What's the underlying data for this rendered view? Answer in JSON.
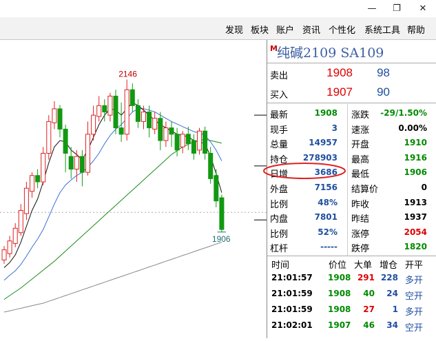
{
  "window": {
    "minimize_glyph": "—",
    "restore_glyph": "❐",
    "close_glyph": "✕"
  },
  "menu": {
    "items": [
      "发现",
      "板块",
      "账户",
      "资讯",
      "个性化",
      "系统工具",
      "帮助"
    ]
  },
  "header": {
    "marker": "M",
    "title": "纯碱2109  SA109"
  },
  "quote": {
    "sell_label": "卖出",
    "sell_price": "1908",
    "sell_qty": "98",
    "buy_label": "买入",
    "buy_price": "1907",
    "buy_qty": "90"
  },
  "stats": [
    {
      "l1": "最新",
      "v1": "1908",
      "c1": "green",
      "l2": "涨跌",
      "v2": "-29/1.50%",
      "c2": "green"
    },
    {
      "l1": "现手",
      "v1": "3",
      "c1": "blue",
      "l2": "速涨",
      "v2": "0.00%",
      "c2": "black"
    },
    {
      "l1": "总量",
      "v1": "14957",
      "c1": "blue",
      "l2": "开盘",
      "v2": "1910",
      "c2": "green"
    },
    {
      "l1": "持仓",
      "v1": "278903",
      "c1": "blue",
      "l2": "最高",
      "v2": "1916",
      "c2": "green"
    },
    {
      "l1": "日增",
      "v1": "3686",
      "c1": "blue",
      "l2": "最低",
      "v2": "1906",
      "c2": "green"
    },
    {
      "l1": "外盘",
      "v1": "7156",
      "c1": "blue",
      "l2": "结算价",
      "v2": "0",
      "c2": "black"
    },
    {
      "l1": "比例",
      "v1": "48%",
      "c1": "blue",
      "l2": "昨收",
      "v2": "1913",
      "c2": "black"
    },
    {
      "l1": "内盘",
      "v1": "7801",
      "c1": "blue",
      "l2": "昨结",
      "v2": "1937",
      "c2": "black"
    },
    {
      "l1": "比例",
      "v1": "52%",
      "c1": "blue",
      "l2": "涨停",
      "v2": "2054",
      "c2": "red"
    },
    {
      "l1": "杠杆",
      "v1": "-----",
      "c1": "blue",
      "l2": "跌停",
      "v2": "1820",
      "c2": "green"
    }
  ],
  "ticks": {
    "headers": [
      "时间",
      "价位",
      "大单",
      "增仓",
      "开平"
    ],
    "rows": [
      {
        "time": "21:01:57",
        "price": "1908",
        "vol": "291",
        "vol_color": "red",
        "oi": "228",
        "type": "多开"
      },
      {
        "time": "21:01:59",
        "price": "1908",
        "vol": "40",
        "vol_color": "green",
        "oi": "24",
        "type": "空开"
      },
      {
        "time": "21:01:59",
        "price": "1908",
        "vol": "27",
        "vol_color": "red",
        "oi": "1",
        "type": "多开"
      },
      {
        "time": "21:02:01",
        "price": "1907",
        "vol": "46",
        "vol_color": "green",
        "oi": "34",
        "type": "空开"
      }
    ]
  },
  "chart_data": {
    "type": "candlestick",
    "high_label": "2146",
    "low_label": "1906",
    "candles": [
      {
        "o": 1862,
        "c": 1878,
        "h": 1884,
        "l": 1856
      },
      {
        "o": 1872,
        "c": 1892,
        "h": 1900,
        "l": 1866
      },
      {
        "o": 1888,
        "c": 1912,
        "h": 1920,
        "l": 1882
      },
      {
        "o": 1905,
        "c": 1940,
        "h": 1950,
        "l": 1900
      },
      {
        "o": 1935,
        "c": 1975,
        "h": 1985,
        "l": 1925
      },
      {
        "o": 1970,
        "c": 1995,
        "h": 2000,
        "l": 1960
      },
      {
        "o": 1995,
        "c": 1985,
        "h": 2005,
        "l": 1975
      },
      {
        "o": 1985,
        "c": 2030,
        "h": 2040,
        "l": 1980
      },
      {
        "o": 2030,
        "c": 2080,
        "h": 2090,
        "l": 2020
      },
      {
        "o": 2078,
        "c": 2100,
        "h": 2112,
        "l": 2068
      },
      {
        "o": 2100,
        "c": 2068,
        "h": 2106,
        "l": 2055
      },
      {
        "o": 2068,
        "c": 2030,
        "h": 2075,
        "l": 2000
      },
      {
        "o": 2025,
        "c": 2005,
        "h": 2040,
        "l": 1990
      },
      {
        "o": 2005,
        "c": 2025,
        "h": 2035,
        "l": 1985
      },
      {
        "o": 2025,
        "c": 2000,
        "h": 2035,
        "l": 1978
      },
      {
        "o": 2000,
        "c": 2060,
        "h": 2080,
        "l": 1995
      },
      {
        "o": 2060,
        "c": 2090,
        "h": 2105,
        "l": 2050
      },
      {
        "o": 2088,
        "c": 2105,
        "h": 2120,
        "l": 2080
      },
      {
        "o": 2105,
        "c": 2095,
        "h": 2115,
        "l": 2080
      },
      {
        "o": 2090,
        "c": 2120,
        "h": 2125,
        "l": 2080
      },
      {
        "o": 2120,
        "c": 2070,
        "h": 2130,
        "l": 2060
      },
      {
        "o": 2070,
        "c": 2060,
        "h": 2110,
        "l": 2048
      },
      {
        "o": 2060,
        "c": 2130,
        "h": 2146,
        "l": 2050
      },
      {
        "o": 2130,
        "c": 2105,
        "h": 2140,
        "l": 2095
      },
      {
        "o": 2105,
        "c": 2080,
        "h": 2115,
        "l": 2070
      },
      {
        "o": 2080,
        "c": 2095,
        "h": 2105,
        "l": 2068
      },
      {
        "o": 2095,
        "c": 2070,
        "h": 2105,
        "l": 2055
      },
      {
        "o": 2068,
        "c": 2085,
        "h": 2095,
        "l": 2060
      },
      {
        "o": 2085,
        "c": 2050,
        "h": 2095,
        "l": 2035
      },
      {
        "o": 2050,
        "c": 2070,
        "h": 2080,
        "l": 2040
      },
      {
        "o": 2070,
        "c": 2060,
        "h": 2080,
        "l": 2040
      },
      {
        "o": 2060,
        "c": 2035,
        "h": 2070,
        "l": 2025
      },
      {
        "o": 2040,
        "c": 2060,
        "h": 2065,
        "l": 2030
      },
      {
        "o": 2060,
        "c": 2045,
        "h": 2072,
        "l": 2035
      },
      {
        "o": 2050,
        "c": 2030,
        "h": 2060,
        "l": 2020
      },
      {
        "o": 2035,
        "c": 2065,
        "h": 2070,
        "l": 2028
      },
      {
        "o": 2065,
        "c": 2030,
        "h": 2072,
        "l": 2020
      },
      {
        "o": 2030,
        "c": 1990,
        "h": 2040,
        "l": 1982
      },
      {
        "o": 1995,
        "c": 1955,
        "h": 2005,
        "l": 1945
      },
      {
        "o": 1960,
        "c": 1910,
        "h": 1965,
        "l": 1906
      }
    ],
    "ma_fast": [
      1850,
      1858,
      1870,
      1890,
      1915,
      1940,
      1958,
      1985,
      2015,
      2040,
      2050,
      2048,
      2035,
      2028,
      2020,
      2035,
      2055,
      2075,
      2090,
      2100,
      2098,
      2090,
      2100,
      2110,
      2105,
      2098,
      2090,
      2082,
      2075,
      2070,
      2065,
      2060,
      2058,
      2056,
      2050,
      2048,
      2045,
      2025,
      1998,
      1968
    ],
    "ma_mid": [
      1830,
      1838,
      1845,
      1855,
      1868,
      1882,
      1895,
      1910,
      1930,
      1950,
      1968,
      1980,
      1988,
      1995,
      2000,
      2008,
      2018,
      2030,
      2045,
      2058,
      2068,
      2075,
      2085,
      2095,
      2100,
      2100,
      2098,
      2095,
      2090,
      2085,
      2080,
      2076,
      2072,
      2068,
      2064,
      2062,
      2058,
      2048,
      2035,
      2018
    ],
    "ma_slow": [
      1800,
      1806,
      1812,
      1818,
      1825,
      1832,
      1839,
      1846,
      1853,
      1860,
      1868,
      1876,
      1884,
      1892,
      1900,
      1908,
      1916,
      1924,
      1932,
      1940,
      1948,
      1956,
      1964,
      1972,
      1980,
      1988,
      1996,
      2004,
      2012,
      2020,
      2028,
      2034,
      2040,
      2044,
      2048,
      2050,
      2052,
      2050,
      2048,
      2046
    ],
    "ma_long": [
      1780,
      1782,
      1784,
      1786,
      1788,
      1790,
      1792,
      1794,
      1797,
      1800,
      1803,
      1806,
      1809,
      1812,
      1815,
      1818,
      1821,
      1824,
      1827,
      1830,
      1833,
      1836,
      1839,
      1842,
      1845,
      1848,
      1851,
      1854,
      1857,
      1860,
      1863,
      1866,
      1869,
      1872,
      1875,
      1878,
      1881,
      1884,
      1887,
      1890
    ],
    "ylim": [
      1780,
      2165
    ],
    "ref_price": 1937
  }
}
